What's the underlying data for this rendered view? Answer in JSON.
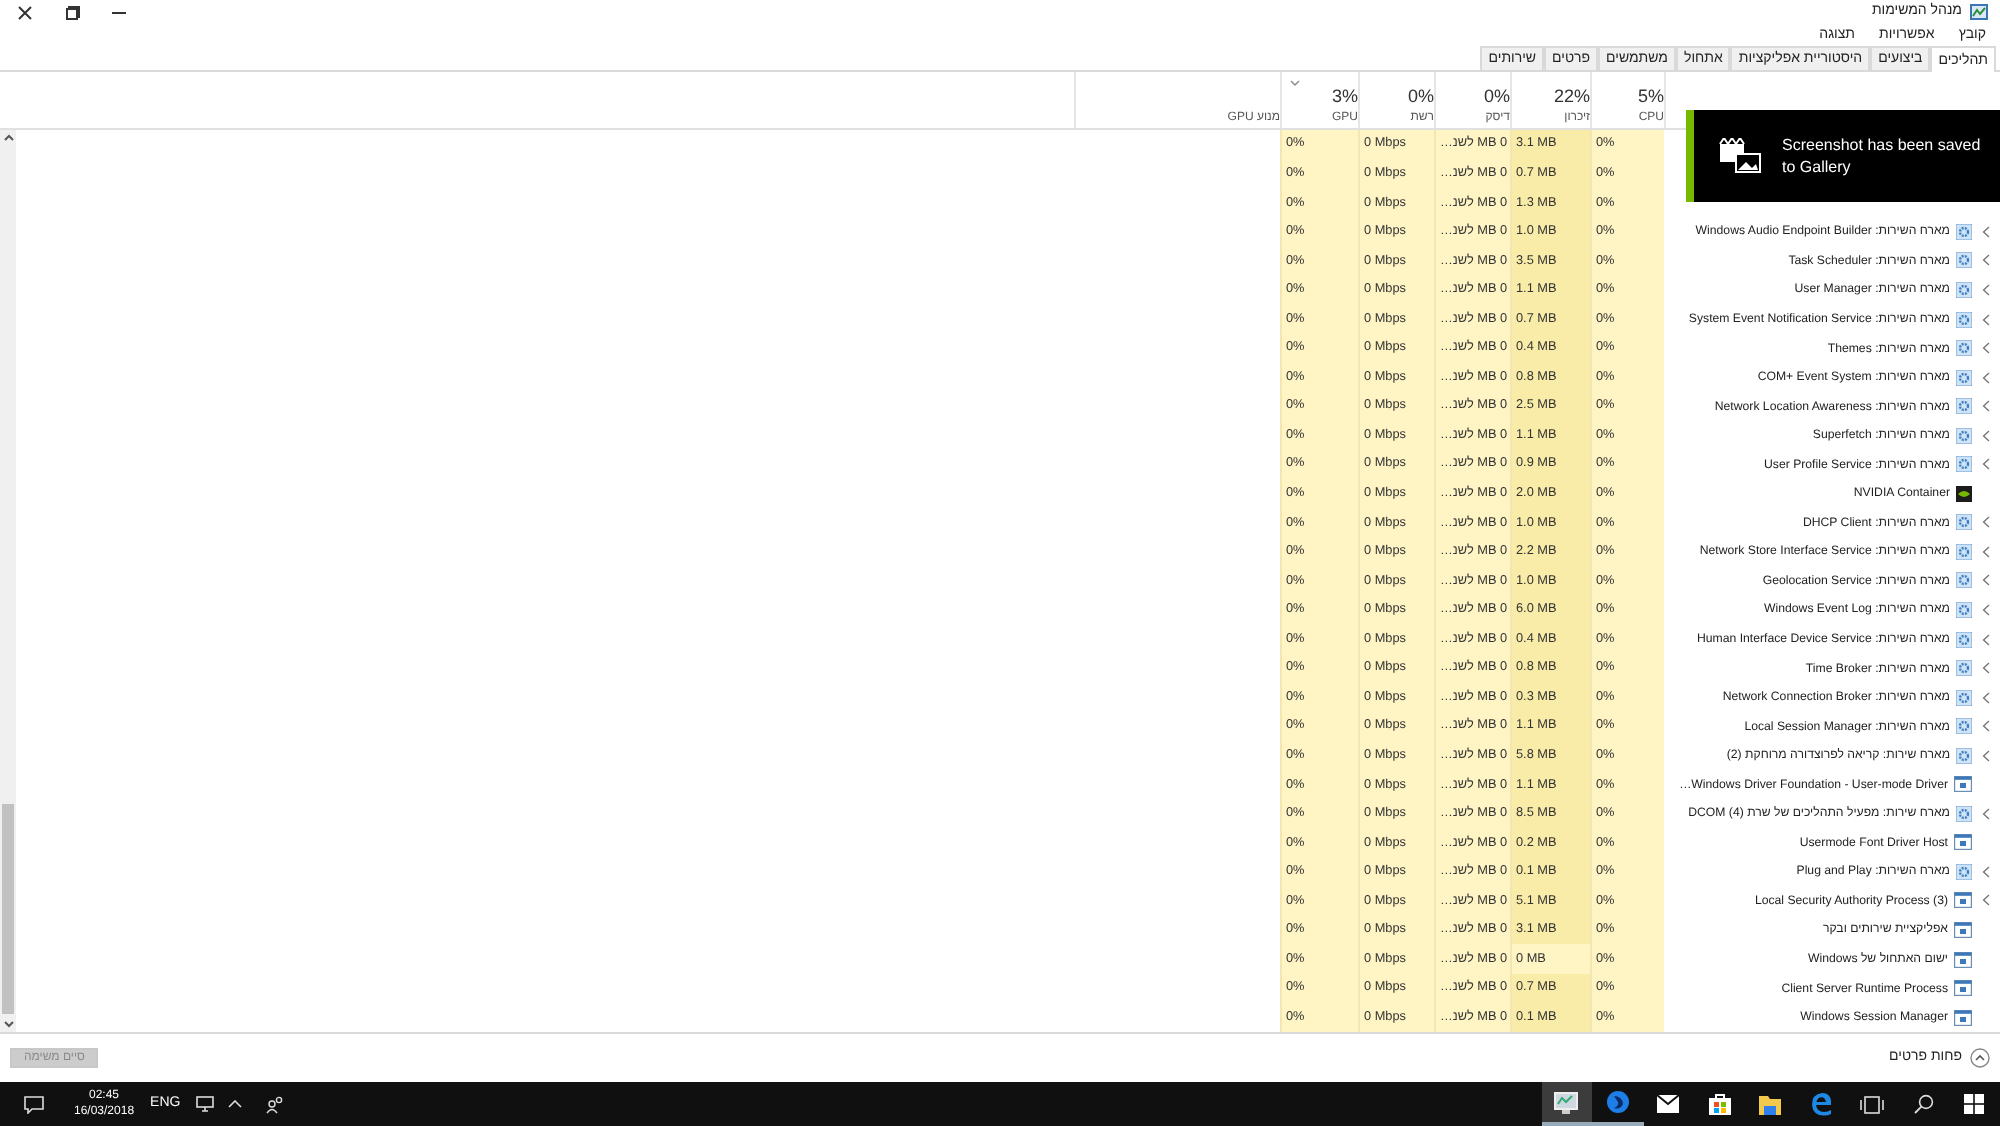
{
  "window": {
    "title": "מנהל המשימות"
  },
  "menu": [
    "קובץ",
    "אפשרויות",
    "תצוגה"
  ],
  "tabs": [
    {
      "label": "תהליכים",
      "selected": true
    },
    {
      "label": "ביצועים",
      "selected": false
    },
    {
      "label": "היסטוריית אפליקציות",
      "selected": false
    },
    {
      "label": "אתחול",
      "selected": false
    },
    {
      "label": "משתמשים",
      "selected": false
    },
    {
      "label": "פרטים",
      "selected": false
    },
    {
      "label": "שירותים",
      "selected": false
    }
  ],
  "columns": [
    {
      "percent": "5%",
      "label": "CPU",
      "sorted": false
    },
    {
      "percent": "22%",
      "label": "זיכרון",
      "sorted": false
    },
    {
      "percent": "0%",
      "label": "דיסק",
      "sorted": false
    },
    {
      "percent": "0%",
      "label": "רשת",
      "sorted": false
    },
    {
      "percent": "3%",
      "label": "GPU",
      "sorted": true
    },
    {
      "label": "מנוע GPU",
      "sorted": false
    }
  ],
  "rows": [
    {
      "cpu": "0%",
      "memory": "3.1 MB",
      "memory_low": false,
      "disk": "0 MB לשנ…",
      "network": "0 Mbps",
      "gpu": "0%"
    },
    {
      "cpu": "0%",
      "memory": "0.7 MB",
      "memory_low": false,
      "disk": "0 MB לשנ…",
      "network": "0 Mbps",
      "gpu": "0%"
    },
    {
      "cpu": "0%",
      "memory": "1.3 MB",
      "memory_low": false,
      "disk": "0 MB לשנ…",
      "network": "0 Mbps",
      "gpu": "0%"
    },
    {
      "kind": "service",
      "name": "מארח השירות: Windows Audio Endpoint Builder",
      "expandable": true,
      "cpu": "0%",
      "memory": "1.0 MB",
      "memory_low": false,
      "disk": "0 MB לשנ…",
      "network": "0 Mbps",
      "gpu": "0%"
    },
    {
      "kind": "service",
      "name": "מארח השירות: Task Scheduler",
      "expandable": true,
      "cpu": "0%",
      "memory": "3.5 MB",
      "memory_low": false,
      "disk": "0 MB לשנ…",
      "network": "0 Mbps",
      "gpu": "0%"
    },
    {
      "kind": "service",
      "name": "מארח השירות: User Manager",
      "expandable": true,
      "cpu": "0%",
      "memory": "1.1 MB",
      "memory_low": false,
      "disk": "0 MB לשנ…",
      "network": "0 Mbps",
      "gpu": "0%"
    },
    {
      "kind": "service",
      "name": "מארח השירות: System Event Notification Service",
      "expandable": true,
      "cpu": "0%",
      "memory": "0.7 MB",
      "memory_low": false,
      "disk": "0 MB לשנ…",
      "network": "0 Mbps",
      "gpu": "0%"
    },
    {
      "kind": "service",
      "name": "מארח השירות: Themes",
      "expandable": true,
      "cpu": "0%",
      "memory": "0.4 MB",
      "memory_low": false,
      "disk": "0 MB לשנ…",
      "network": "0 Mbps",
      "gpu": "0%"
    },
    {
      "kind": "service",
      "name": "מארח השירות: COM+ Event System",
      "expandable": true,
      "cpu": "0%",
      "memory": "0.8 MB",
      "memory_low": false,
      "disk": "0 MB לשנ…",
      "network": "0 Mbps",
      "gpu": "0%"
    },
    {
      "kind": "service",
      "name": "מארח השירות: Network Location Awareness",
      "expandable": true,
      "cpu": "0%",
      "memory": "2.5 MB",
      "memory_low": false,
      "disk": "0 MB לשנ…",
      "network": "0 Mbps",
      "gpu": "0%"
    },
    {
      "kind": "service",
      "name": "מארח השירות: Superfetch",
      "expandable": true,
      "cpu": "0%",
      "memory": "1.1 MB",
      "memory_low": false,
      "disk": "0 MB לשנ…",
      "network": "0 Mbps",
      "gpu": "0%"
    },
    {
      "kind": "service",
      "name": "מארח השירות: User Profile Service",
      "expandable": true,
      "cpu": "0%",
      "memory": "0.9 MB",
      "memory_low": false,
      "disk": "0 MB לשנ…",
      "network": "0 Mbps",
      "gpu": "0%"
    },
    {
      "kind": "nvidia",
      "name": "NVIDIA Container",
      "expandable": false,
      "cpu": "0%",
      "memory": "2.0 MB",
      "memory_low": false,
      "disk": "0 MB לשנ…",
      "network": "0 Mbps",
      "gpu": "0%"
    },
    {
      "kind": "service",
      "name": "מארח השירות: DHCP Client",
      "expandable": true,
      "cpu": "0%",
      "memory": "1.0 MB",
      "memory_low": false,
      "disk": "0 MB לשנ…",
      "network": "0 Mbps",
      "gpu": "0%"
    },
    {
      "kind": "service",
      "name": "מארח השירות: Network Store Interface Service",
      "expandable": true,
      "cpu": "0%",
      "memory": "2.2 MB",
      "memory_low": false,
      "disk": "0 MB לשנ…",
      "network": "0 Mbps",
      "gpu": "0%"
    },
    {
      "kind": "service",
      "name": "מארח השירות: Geolocation Service",
      "expandable": true,
      "cpu": "0%",
      "memory": "1.0 MB",
      "memory_low": false,
      "disk": "0 MB לשנ…",
      "network": "0 Mbps",
      "gpu": "0%"
    },
    {
      "kind": "service",
      "name": "מארח השירות: Windows Event Log",
      "expandable": true,
      "cpu": "0%",
      "memory": "6.0 MB",
      "memory_low": false,
      "disk": "0 MB לשנ…",
      "network": "0 Mbps",
      "gpu": "0%"
    },
    {
      "kind": "service",
      "name": "מארח השירות: Human Interface Device Service",
      "expandable": true,
      "cpu": "0%",
      "memory": "0.4 MB",
      "memory_low": false,
      "disk": "0 MB לשנ…",
      "network": "0 Mbps",
      "gpu": "0%"
    },
    {
      "kind": "service",
      "name": "מארח השירות: Time Broker",
      "expandable": true,
      "cpu": "0%",
      "memory": "0.8 MB",
      "memory_low": false,
      "disk": "0 MB לשנ…",
      "network": "0 Mbps",
      "gpu": "0%"
    },
    {
      "kind": "service",
      "name": "מארח השירות: Network Connection Broker",
      "expandable": true,
      "cpu": "0%",
      "memory": "0.3 MB",
      "memory_low": false,
      "disk": "0 MB לשנ…",
      "network": "0 Mbps",
      "gpu": "0%"
    },
    {
      "kind": "service",
      "name": "מארח השירות: Local Session Manager",
      "expandable": true,
      "cpu": "0%",
      "memory": "1.1 MB",
      "memory_low": false,
      "disk": "0 MB לשנ…",
      "network": "0 Mbps",
      "gpu": "0%"
    },
    {
      "kind": "service",
      "name": "מארח שירות: קריאה לפרוצדורה מרוחקת (2)",
      "expandable": true,
      "cpu": "0%",
      "memory": "5.8 MB",
      "memory_low": false,
      "disk": "0 MB לשנ…",
      "network": "0 Mbps",
      "gpu": "0%"
    },
    {
      "kind": "app",
      "name": "Windows Driver Foundation - User-mode Driver…",
      "expandable": false,
      "cpu": "0%",
      "memory": "1.1 MB",
      "memory_low": false,
      "disk": "0 MB לשנ…",
      "network": "0 Mbps",
      "gpu": "0%"
    },
    {
      "kind": "service",
      "name": "מארח שירות: מפעיל התהליכים של שרת DCOM (4)",
      "expandable": true,
      "cpu": "0%",
      "memory": "8.5 MB",
      "memory_low": false,
      "disk": "0 MB לשנ…",
      "network": "0 Mbps",
      "gpu": "0%"
    },
    {
      "kind": "app",
      "name": "Usermode Font Driver Host",
      "expandable": false,
      "cpu": "0%",
      "memory": "0.2 MB",
      "memory_low": false,
      "disk": "0 MB לשנ…",
      "network": "0 Mbps",
      "gpu": "0%"
    },
    {
      "kind": "service",
      "name": "מארח השירות: Plug and Play",
      "expandable": true,
      "cpu": "0%",
      "memory": "0.1 MB",
      "memory_low": false,
      "disk": "0 MB לשנ…",
      "network": "0 Mbps",
      "gpu": "0%"
    },
    {
      "kind": "app",
      "name": "Local Security Authority Process (3)",
      "expandable": true,
      "cpu": "0%",
      "memory": "5.1 MB",
      "memory_low": false,
      "disk": "0 MB לשנ…",
      "network": "0 Mbps",
      "gpu": "0%"
    },
    {
      "kind": "app",
      "name": "אפליקציית שירותים ובקר",
      "expandable": false,
      "cpu": "0%",
      "memory": "3.1 MB",
      "memory_low": false,
      "disk": "0 MB לשנ…",
      "network": "0 Mbps",
      "gpu": "0%"
    },
    {
      "kind": "app",
      "name": "ישום האתחול של Windows",
      "expandable": false,
      "cpu": "0%",
      "memory": "0 MB",
      "memory_low": true,
      "disk": "0 MB לשנ…",
      "network": "0 Mbps",
      "gpu": "0%"
    },
    {
      "kind": "app",
      "name": "Client Server Runtime Process",
      "expandable": false,
      "cpu": "0%",
      "memory": "0.7 MB",
      "memory_low": false,
      "disk": "0 MB לשנ…",
      "network": "0 Mbps",
      "gpu": "0%"
    },
    {
      "kind": "app",
      "name": "Windows Session Manager",
      "expandable": false,
      "cpu": "0%",
      "memory": "0.1 MB",
      "memory_low": false,
      "disk": "0 MB לשנ…",
      "network": "0 Mbps",
      "gpu": "0%"
    }
  ],
  "toast": {
    "text": "Screenshot has been saved to Gallery"
  },
  "footer": {
    "fewer_details": "פחות פרטים",
    "end_task": {
      "label": "סיים משימה",
      "disabled": true
    }
  },
  "taskbar": {
    "language": "ENG",
    "time": "02:45",
    "date": "16/03/2018"
  }
}
